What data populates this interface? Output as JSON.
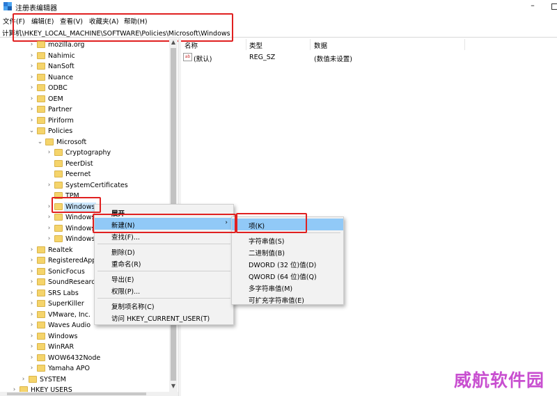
{
  "window": {
    "title": "注册表编辑器",
    "minimize": "–",
    "maximize_icon": "maximize-icon"
  },
  "menu": [
    "文件(F)",
    "编辑(E)",
    "查看(V)",
    "收藏夹(A)",
    "帮助(H)"
  ],
  "address": "计算机\\HKEY_LOCAL_MACHINE\\SOFTWARE\\Policies\\Microsoft\\Windows",
  "tree": [
    {
      "label": "mozilla.org",
      "expanded": false
    },
    {
      "label": "Nahimic",
      "expanded": false
    },
    {
      "label": "NanSoft",
      "expanded": false
    },
    {
      "label": "Nuance",
      "expanded": false
    },
    {
      "label": "ODBC",
      "expanded": false
    },
    {
      "label": "OEM",
      "expanded": false
    },
    {
      "label": "Partner",
      "expanded": false
    },
    {
      "label": "Piriform",
      "expanded": false
    },
    {
      "label": "Policies",
      "expanded": true
    },
    {
      "label": "Microsoft",
      "expanded": true
    },
    {
      "label": "Cryptography",
      "expanded": false
    },
    {
      "label": "PeerDist",
      "expanded": null
    },
    {
      "label": "Peernet",
      "expanded": null
    },
    {
      "label": "SystemCertificates",
      "expanded": false
    },
    {
      "label": "TPM",
      "expanded": null
    },
    {
      "label": "Windows",
      "expanded": false,
      "selected": true
    },
    {
      "label": "Windows",
      "expanded": false
    },
    {
      "label": "Windows",
      "expanded": false
    },
    {
      "label": "Windows",
      "expanded": false
    },
    {
      "label": "Realtek",
      "expanded": false
    },
    {
      "label": "RegisteredApp",
      "expanded": false
    },
    {
      "label": "SonicFocus",
      "expanded": false
    },
    {
      "label": "SoundResearc",
      "expanded": false
    },
    {
      "label": "SRS Labs",
      "expanded": false
    },
    {
      "label": "SuperKiller",
      "expanded": false
    },
    {
      "label": "VMware, Inc.",
      "expanded": false
    },
    {
      "label": "Waves Audio",
      "expanded": false
    },
    {
      "label": "Windows",
      "expanded": false
    },
    {
      "label": "WinRAR",
      "expanded": false
    },
    {
      "label": "WOW6432Node",
      "expanded": false
    },
    {
      "label": "Yamaha APO",
      "expanded": false
    },
    {
      "label": "SYSTEM",
      "expanded": false
    },
    {
      "label": "HKEY USERS",
      "expanded": false
    }
  ],
  "columns": {
    "name": "名称",
    "type": "类型",
    "data": "数据"
  },
  "values": [
    {
      "name": "(默认)",
      "type": "REG_SZ",
      "data": "(数值未设置)",
      "icon": "string-value-icon",
      "icon_text": "ab"
    }
  ],
  "context_menu": {
    "items": [
      {
        "label": "展开",
        "bold": true
      },
      {
        "label": "新建(N)",
        "submenu": true,
        "highlighted": true
      },
      {
        "label": "查找(F)..."
      },
      {
        "label": "删除(D)"
      },
      {
        "label": "重命名(R)"
      },
      {
        "label": "导出(E)"
      },
      {
        "label": "权限(P)..."
      },
      {
        "label": "复制项名称(C)"
      },
      {
        "label": "访问 HKEY_CURRENT_USER(T)"
      }
    ],
    "submenu_arrow": "›"
  },
  "new_submenu": {
    "items": [
      {
        "label": "项(K)",
        "highlighted": true
      },
      {
        "label": "字符串值(S)"
      },
      {
        "label": "二进制值(B)"
      },
      {
        "label": "DWORD (32 位)值(D)"
      },
      {
        "label": "QWORD (64 位)值(Q)"
      },
      {
        "label": "多字符串值(M)"
      },
      {
        "label": "可扩充字符串值(E)"
      }
    ]
  },
  "watermark": "威航软件园",
  "colors": {
    "highlight_box": "#e02020",
    "menu_selected": "#91c9f7",
    "tree_selected": "#cce8ff",
    "folder": "#f5d46b",
    "watermark": "#c84fd0"
  }
}
